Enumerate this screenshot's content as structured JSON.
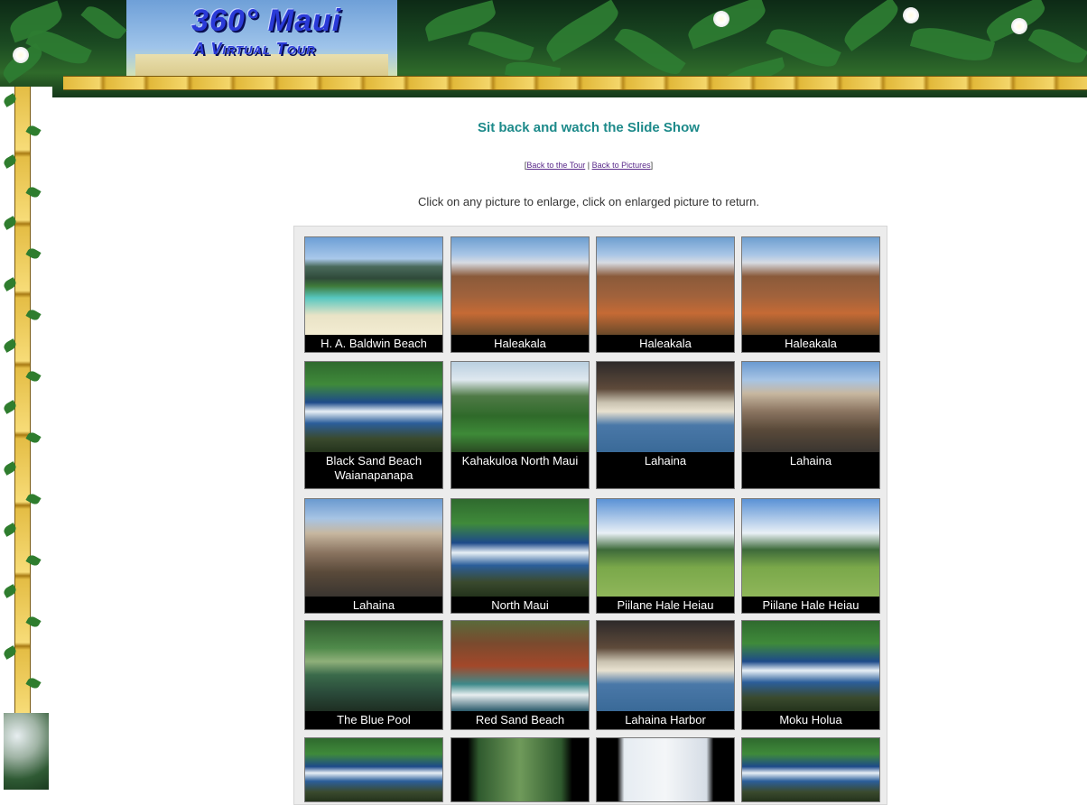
{
  "header": {
    "logo_line1": "360° Maui",
    "logo_line2": "A Virtual Tour"
  },
  "heading": "Sit back and watch the Slide Show",
  "nav": {
    "open_bracket": "[",
    "back_to_tour": "Back to the Tour",
    "separator": " | ",
    "back_to_pictures": "Back to Pictures",
    "close_bracket": "]"
  },
  "instructions": "Click on any picture to enlarge, click on enlarged picture to return.",
  "gallery": {
    "thumbnails": [
      {
        "caption": "H. A. Baldwin Beach",
        "icon": "beach-photo"
      },
      {
        "caption": "Haleakala",
        "icon": "crater-photo"
      },
      {
        "caption": "Haleakala",
        "icon": "crater-photo"
      },
      {
        "caption": "Haleakala",
        "icon": "crater-photo"
      },
      {
        "caption": "Black Sand Beach Waianapanapa",
        "icon": "coast-photo"
      },
      {
        "caption": "Kahakuloa North Maui",
        "icon": "valley-photo"
      },
      {
        "caption": "Lahaina",
        "icon": "harbor-photo"
      },
      {
        "caption": "Lahaina",
        "icon": "street-photo"
      },
      {
        "caption": "Lahaina",
        "icon": "street-photo"
      },
      {
        "caption": "North Maui",
        "icon": "coast-photo"
      },
      {
        "caption": "Piilane Hale Heiau",
        "icon": "field-photo"
      },
      {
        "caption": "Piilane Hale Heiau",
        "icon": "field-photo"
      },
      {
        "caption": "The Blue Pool",
        "icon": "pool-photo"
      },
      {
        "caption": "Red Sand Beach",
        "icon": "cove-photo"
      },
      {
        "caption": "Lahaina Harbor",
        "icon": "harbor-photo"
      },
      {
        "caption": "Moku Holua",
        "icon": "coast-photo"
      },
      {
        "caption": "",
        "icon": "coast-photo"
      },
      {
        "caption": "",
        "icon": "forest-photo"
      },
      {
        "caption": "",
        "icon": "sky-photo"
      },
      {
        "caption": "",
        "icon": "coast-photo"
      }
    ]
  }
}
